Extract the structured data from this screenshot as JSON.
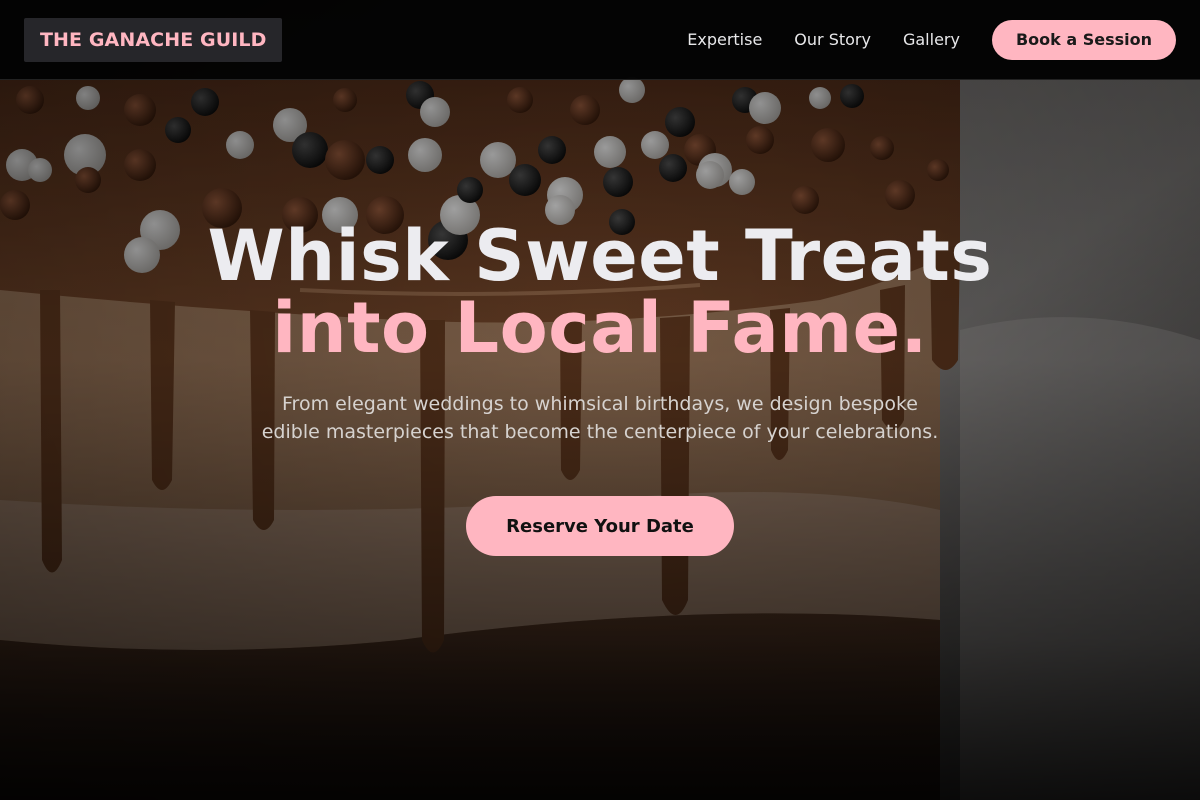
{
  "nav": {
    "brand": "THE GANACHE GUILD",
    "links": [
      "Expertise",
      "Our Story",
      "Gallery"
    ],
    "cta_label": "Book a Session"
  },
  "hero": {
    "headline_line1": "Whisk Sweet Treats",
    "headline_line2": "into Local Fame.",
    "subtitle": "From elegant weddings to whimsical birthdays, we design bespoke edible masterpieces that become the centerpiece of your celebrations.",
    "cta_label": "Reserve Your Date",
    "background_image": "chocolate-drip-cake-photo"
  },
  "colors": {
    "accent": "#ffb6c1",
    "nav_bg": "#020202",
    "brand_bg": "#26262a",
    "headline_white": "#ececf0",
    "text_muted": "#d6d2cf"
  }
}
